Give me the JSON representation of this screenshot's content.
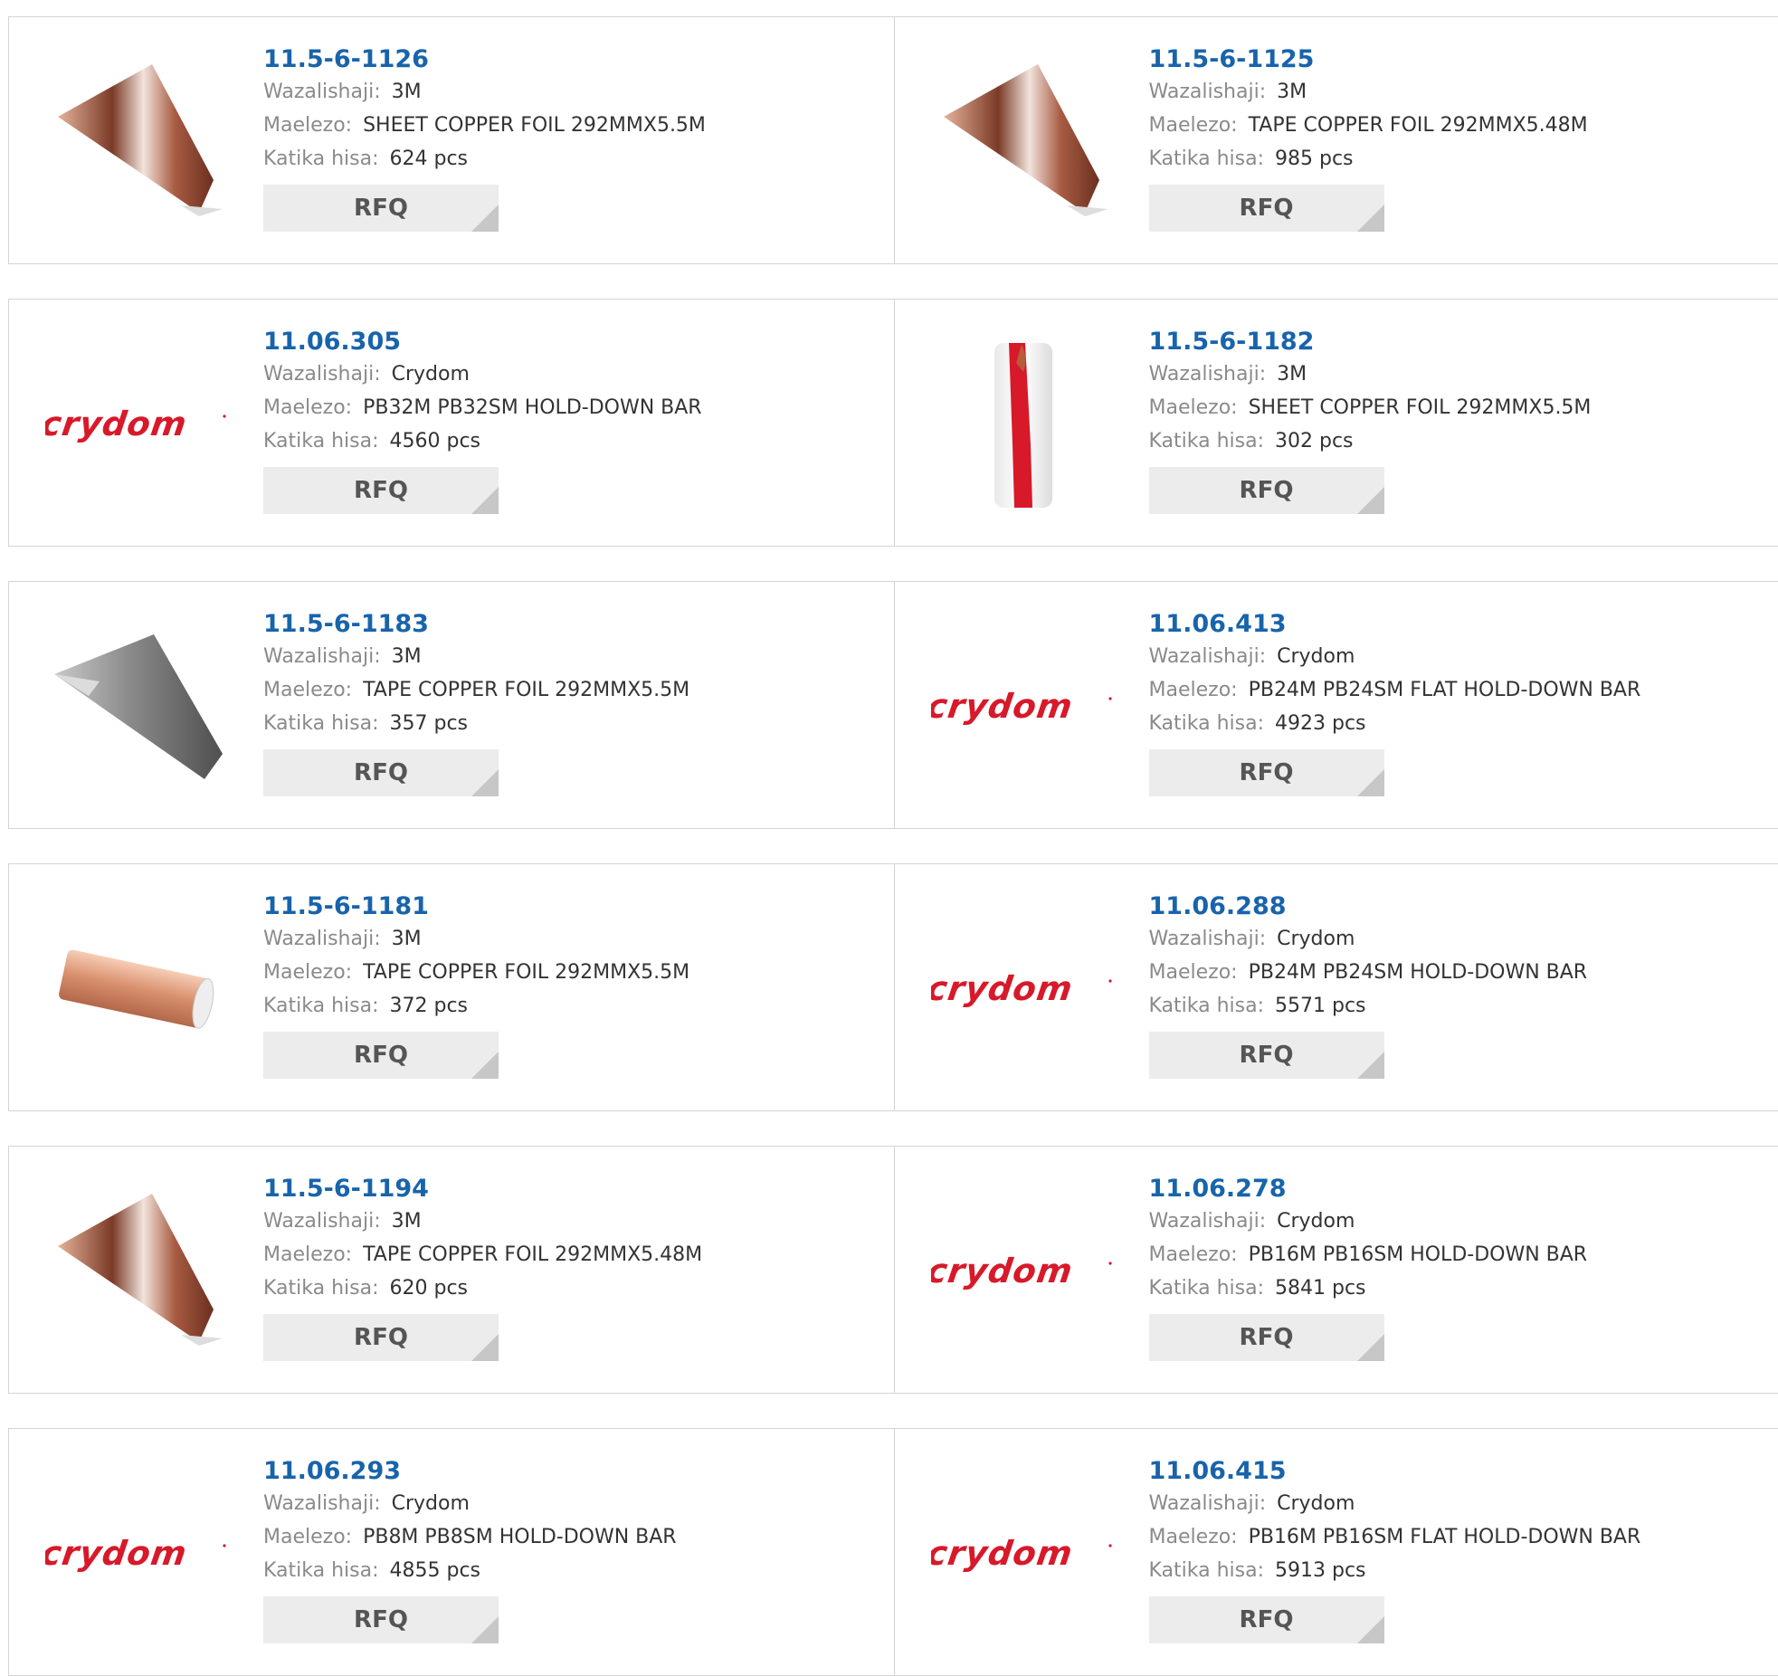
{
  "labels": {
    "manufacturer": "Wazalishaji:",
    "description": "Maelezo:",
    "stock": "Katika hisa:",
    "rfq": "RFQ"
  },
  "brand_logo_text": "crydom",
  "brand_color": "#d7192a",
  "accent_color": "#1864ab",
  "products": [
    {
      "part": "11.5-6-1126",
      "manufacturer": "3M",
      "description": "SHEET COPPER FOIL 292MMX5.5M",
      "stock": "624 pcs",
      "image": "copper-foil-roll-image"
    },
    {
      "part": "11.5-6-1125",
      "manufacturer": "3M",
      "description": "TAPE COPPER FOIL 292MMX5.48M",
      "stock": "985 pcs",
      "image": "copper-foil-roll-image"
    },
    {
      "part": "11.06.305",
      "manufacturer": "Crydom",
      "description": "PB32M PB32SM HOLD-DOWN BAR",
      "stock": "4560 pcs",
      "image": "crydom-logo"
    },
    {
      "part": "11.5-6-1182",
      "manufacturer": "3M",
      "description": "SHEET COPPER FOIL 292MMX5.5M",
      "stock": "302 pcs",
      "image": "red-white-roll-image"
    },
    {
      "part": "11.5-6-1183",
      "manufacturer": "3M",
      "description": "TAPE COPPER FOIL 292MMX5.5M",
      "stock": "357 pcs",
      "image": "silver-foil-roll-image"
    },
    {
      "part": "11.06.413",
      "manufacturer": "Crydom",
      "description": "PB24M PB24SM FLAT HOLD-DOWN BAR",
      "stock": "4923 pcs",
      "image": "crydom-logo"
    },
    {
      "part": "11.5-6-1181",
      "manufacturer": "3M",
      "description": "TAPE COPPER FOIL 292MMX5.5M",
      "stock": "372 pcs",
      "image": "copper-tape-tube-image"
    },
    {
      "part": "11.06.288",
      "manufacturer": "Crydom",
      "description": "PB24M PB24SM HOLD-DOWN BAR",
      "stock": "5571 pcs",
      "image": "crydom-logo"
    },
    {
      "part": "11.5-6-1194",
      "manufacturer": "3M",
      "description": "TAPE COPPER FOIL 292MMX5.48M",
      "stock": "620 pcs",
      "image": "copper-foil-roll-image"
    },
    {
      "part": "11.06.278",
      "manufacturer": "Crydom",
      "description": "PB16M PB16SM HOLD-DOWN BAR",
      "stock": "5841 pcs",
      "image": "crydom-logo"
    },
    {
      "part": "11.06.293",
      "manufacturer": "Crydom",
      "description": "PB8M PB8SM HOLD-DOWN BAR",
      "stock": "4855 pcs",
      "image": "crydom-logo"
    },
    {
      "part": "11.06.415",
      "manufacturer": "Crydom",
      "description": "PB16M PB16SM FLAT HOLD-DOWN BAR",
      "stock": "5913 pcs",
      "image": "crydom-logo"
    }
  ]
}
